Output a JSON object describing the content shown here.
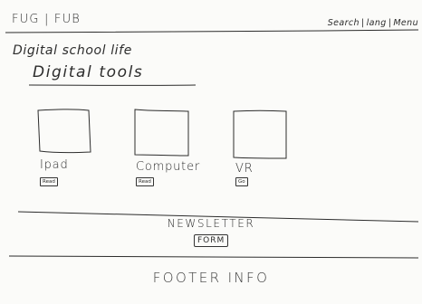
{
  "header": {
    "logo": "FUG | FUB",
    "nav": [
      {
        "label": "Search"
      },
      {
        "label": "lang"
      },
      {
        "label": "Menu"
      }
    ],
    "separator": "|"
  },
  "hero": {
    "title": "Digital school life",
    "subtitle": "Digital tools"
  },
  "tools": [
    {
      "label": "Ipad",
      "button": "Read"
    },
    {
      "label": "Computer",
      "button": "Read"
    },
    {
      "label": "VR",
      "button": "Go"
    }
  ],
  "newsletter": {
    "title": "NEWSLETTER",
    "button": "FORM"
  },
  "footer": {
    "text": "FOOTER INFO"
  },
  "colors": {
    "ink": "#2c2c2c",
    "paper": "#fbfbf9"
  }
}
